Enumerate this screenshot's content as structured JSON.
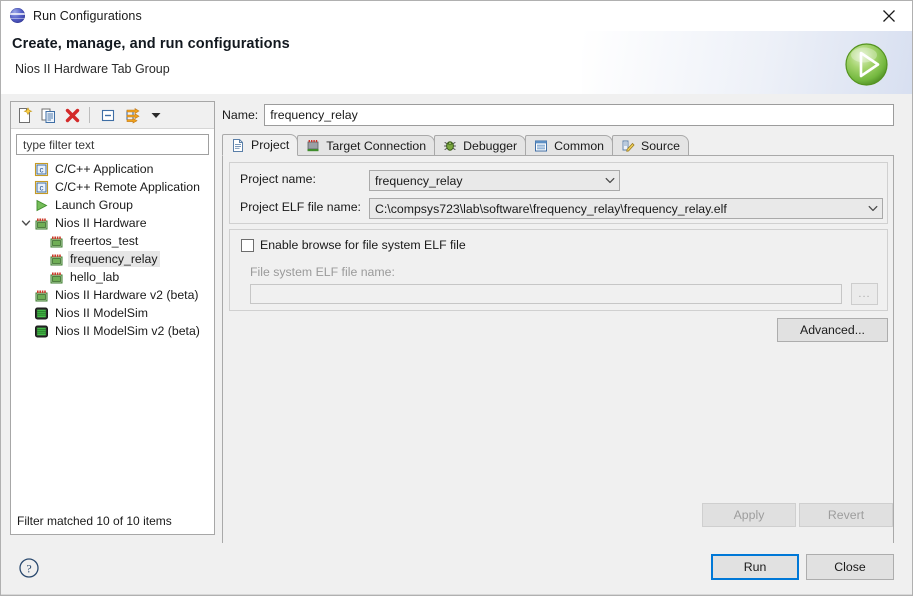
{
  "window": {
    "title": "Run Configurations",
    "title_icon": "globe-icon",
    "close_icon": "close-icon"
  },
  "banner": {
    "heading": "Create, manage, and run configurations",
    "subheading": "Nios II Hardware Tab Group",
    "icon": "run-green-play-icon"
  },
  "left_panel": {
    "toolbar": [
      {
        "name": "new-launch-configuration-icon",
        "tooltip": "New launch configuration"
      },
      {
        "name": "duplicate-launch-configuration-icon",
        "tooltip": "Duplicate"
      },
      {
        "name": "delete-launch-configuration-icon",
        "tooltip": "Delete"
      },
      {
        "name": "collapse-all-icon",
        "tooltip": "Collapse All"
      },
      {
        "name": "filter-launch-configurations-icon",
        "tooltip": "Filter"
      },
      {
        "name": "view-menu-chevron-down-icon",
        "tooltip": "View Menu"
      }
    ],
    "filter": {
      "value": "",
      "placeholder": "type filter text"
    },
    "tree": [
      {
        "label": "C/C++ Application",
        "icon": "c-application-icon",
        "indent": 1,
        "twisty": "none",
        "selected": false
      },
      {
        "label": "C/C++ Remote Application",
        "icon": "c-application-icon",
        "indent": 1,
        "twisty": "none",
        "selected": false
      },
      {
        "label": "Launch Group",
        "icon": "launch-group-icon",
        "indent": 1,
        "twisty": "none",
        "selected": false
      },
      {
        "label": "Nios II Hardware",
        "icon": "nios-hardware-icon",
        "indent": 1,
        "twisty": "expanded",
        "selected": false
      },
      {
        "label": "freertos_test",
        "icon": "nios-hardware-icon",
        "indent": 2,
        "twisty": "none",
        "selected": false
      },
      {
        "label": "frequency_relay",
        "icon": "nios-hardware-icon",
        "indent": 2,
        "twisty": "none",
        "selected": true
      },
      {
        "label": "hello_lab",
        "icon": "nios-hardware-icon",
        "indent": 2,
        "twisty": "none",
        "selected": false
      },
      {
        "label": "Nios II Hardware v2 (beta)",
        "icon": "nios-hardware-icon",
        "indent": 1,
        "twisty": "none",
        "selected": false
      },
      {
        "label": "Nios II ModelSim",
        "icon": "nios-modelsim-icon",
        "indent": 1,
        "twisty": "none",
        "selected": false
      },
      {
        "label": "Nios II ModelSim v2 (beta)",
        "icon": "nios-modelsim-icon",
        "indent": 1,
        "twisty": "none",
        "selected": false
      }
    ],
    "status": "Filter matched 10 of 10 items"
  },
  "right_panel": {
    "name_label": "Name:",
    "name_value": "frequency_relay",
    "tabs": [
      {
        "label": "Project",
        "icon": "project-file-icon",
        "active": true
      },
      {
        "label": "Target Connection",
        "icon": "target-connection-icon",
        "active": false
      },
      {
        "label": "Debugger",
        "icon": "debugger-bug-icon",
        "active": false
      },
      {
        "label": "Common",
        "icon": "common-list-icon",
        "active": false
      },
      {
        "label": "Source",
        "icon": "source-edit-icon",
        "active": false
      }
    ],
    "project_tab": {
      "project_name_label": "Project name:",
      "project_name_value": "frequency_relay",
      "elf_label": "Project ELF file name:",
      "elf_value": "C:\\compsys723\\lab\\software\\frequency_relay\\frequency_relay.elf",
      "enable_browse_label": "Enable browse for file system ELF file",
      "enable_browse_checked": false,
      "fs_elf_label": "File system ELF file name:",
      "fs_elf_value": "",
      "browse_button_label": "...",
      "advanced_button_label": "Advanced..."
    },
    "apply_label": "Apply",
    "revert_label": "Revert"
  },
  "footer": {
    "help_icon": "help-question-icon",
    "run_label": "Run",
    "close_label": "Close"
  },
  "colors": {
    "accent": "#0078d7",
    "banner_bg": "#ffffff",
    "dialog_bg": "#f0f0f0",
    "selection": "#e6e6e6",
    "disabled_text": "#9d9d9d",
    "green_run": "#69b543",
    "delete_red": "#d42a2a"
  }
}
